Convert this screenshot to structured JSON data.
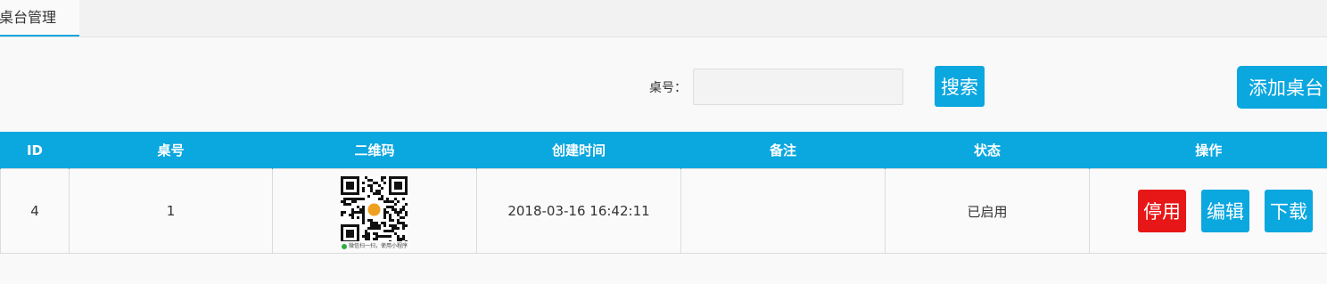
{
  "tabs": [
    {
      "label": "桌台管理",
      "active": true
    }
  ],
  "search": {
    "label": "桌号：",
    "value": "",
    "placeholder": "",
    "button_label": "搜索"
  },
  "add_button_label": "添加桌台",
  "table": {
    "headers": [
      "ID",
      "桌号",
      "二维码",
      "创建时间",
      "备注",
      "状态",
      "操作"
    ],
    "rows": [
      {
        "id": "4",
        "table_no": "1",
        "qr_caption": "微信扫一扫，使用小程序",
        "created_at": "2018-03-16 16:42:11",
        "remark": "",
        "status": "已启用",
        "actions": {
          "disable": "停用",
          "edit": "编辑",
          "download": "下载"
        }
      }
    ]
  },
  "colors": {
    "accent": "#0ba7df",
    "danger": "#e81717",
    "qr_center": "#f0a020"
  }
}
